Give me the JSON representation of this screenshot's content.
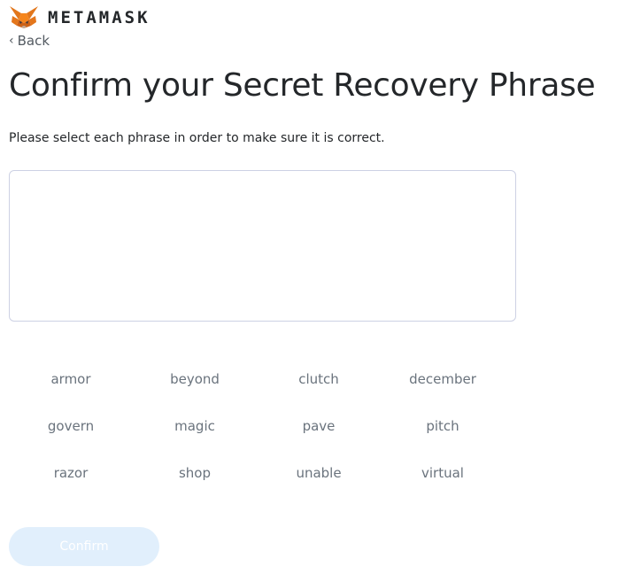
{
  "header": {
    "brand_name": "METAMASK",
    "logo_icon": "metamask-fox-icon"
  },
  "nav": {
    "back_icon": "‹",
    "back_label": "Back"
  },
  "page": {
    "title": "Confirm your Secret Recovery Phrase",
    "instruction": "Please select each phrase in order to make sure it is correct."
  },
  "word_bank": [
    "armor",
    "beyond",
    "clutch",
    "december",
    "govern",
    "magic",
    "pave",
    "pitch",
    "razor",
    "shop",
    "unable",
    "virtual"
  ],
  "actions": {
    "confirm_label": "Confirm",
    "confirm_disabled": true
  },
  "colors": {
    "word_text": "#6a737d",
    "drop_border": "#cdd1e4",
    "confirm_bg_disabled": "#e1effc",
    "fox_orange": "#e2761b"
  }
}
